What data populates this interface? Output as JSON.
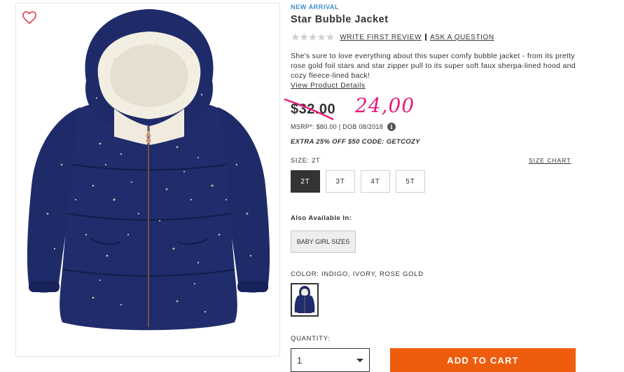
{
  "product": {
    "badge": "NEW ARRIVAL",
    "title": "Star Bubble Jacket",
    "rating_stars": "★★★★★",
    "write_review": "WRITE FIRST REVIEW",
    "ask_question": "ASK A QUESTION",
    "description": "She's sure to love everything about this super comfy bubble jacket - from its pretty rose gold foil stars and star zipper pull to its super soft faux sherpa-lined hood and cozy fleece-lined back!",
    "view_details": "View Product Details",
    "old_price": "$32.00",
    "new_price": "24,00",
    "msrp": "MSRP*: $80.00 | DOB 08/2018",
    "promo": "EXTRA 25% OFF $50 CODE: GETCOZY"
  },
  "size": {
    "label": "SIZE: 2T",
    "chart_link": "SIZE CHART",
    "options": [
      "2T",
      "3T",
      "4T",
      "5T"
    ],
    "selected": "2T"
  },
  "also_available": {
    "label": "Also Available In:",
    "option": "BABY GIRL SIZES"
  },
  "color": {
    "label": "COLOR: INDIGO, IVORY, ROSE GOLD"
  },
  "quantity": {
    "label": "QUANTITY:",
    "value": "1"
  },
  "cart": {
    "button": "ADD TO CART"
  },
  "colors": {
    "badge_blue": "#3d8dcc",
    "sale_pink": "#e8187c",
    "cart_orange": "#ee5d0e",
    "jacket_navy": "#1f2b68"
  }
}
